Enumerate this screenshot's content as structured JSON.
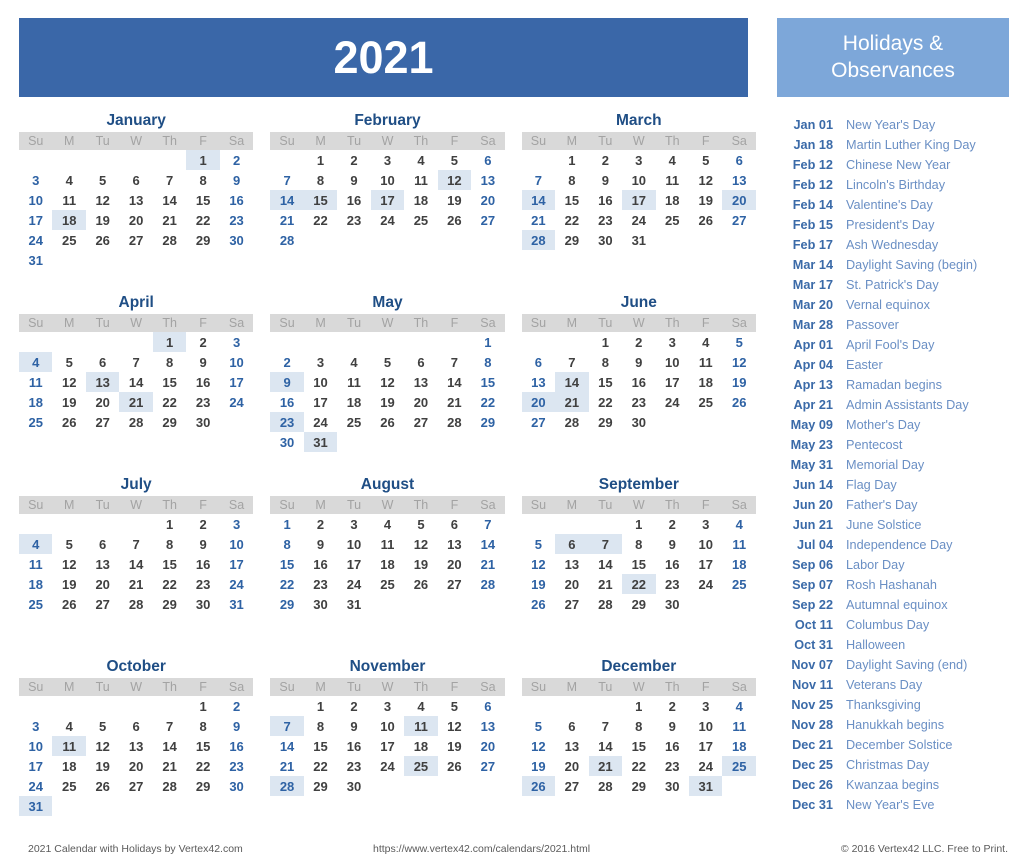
{
  "header": {
    "year_title": "2021",
    "banner_color": "#3a67a8"
  },
  "sidebar": {
    "title": "Holidays & Observances",
    "banner_color": "#7da7d9",
    "date_color": "#3a6aa8",
    "name_color": "#6a8fc4",
    "holidays": [
      {
        "date": "Jan 01",
        "name": "New Year's Day"
      },
      {
        "date": "Jan 18",
        "name": "Martin Luther King Day"
      },
      {
        "date": "Feb 12",
        "name": "Chinese New Year"
      },
      {
        "date": "Feb 12",
        "name": "Lincoln's Birthday"
      },
      {
        "date": "Feb 14",
        "name": "Valentine's Day"
      },
      {
        "date": "Feb 15",
        "name": "President's Day"
      },
      {
        "date": "Feb 17",
        "name": "Ash Wednesday"
      },
      {
        "date": "Mar 14",
        "name": "Daylight Saving (begin)"
      },
      {
        "date": "Mar 17",
        "name": "St. Patrick's Day"
      },
      {
        "date": "Mar 20",
        "name": "Vernal equinox"
      },
      {
        "date": "Mar 28",
        "name": "Passover"
      },
      {
        "date": "Apr 01",
        "name": "April Fool's Day"
      },
      {
        "date": "Apr 04",
        "name": "Easter"
      },
      {
        "date": "Apr 13",
        "name": "Ramadan begins"
      },
      {
        "date": "Apr 21",
        "name": "Admin Assistants Day"
      },
      {
        "date": "May 09",
        "name": "Mother's Day"
      },
      {
        "date": "May 23",
        "name": "Pentecost"
      },
      {
        "date": "May 31",
        "name": "Memorial Day"
      },
      {
        "date": "Jun 14",
        "name": "Flag Day"
      },
      {
        "date": "Jun 20",
        "name": "Father's Day"
      },
      {
        "date": "Jun 21",
        "name": "June Solstice"
      },
      {
        "date": "Jul 04",
        "name": "Independence Day"
      },
      {
        "date": "Sep 06",
        "name": "Labor Day"
      },
      {
        "date": "Sep 07",
        "name": "Rosh Hashanah"
      },
      {
        "date": "Sep 22",
        "name": "Autumnal equinox"
      },
      {
        "date": "Oct 11",
        "name": "Columbus Day"
      },
      {
        "date": "Oct 31",
        "name": "Halloween"
      },
      {
        "date": "Nov 07",
        "name": "Daylight Saving (end)"
      },
      {
        "date": "Nov 11",
        "name": "Veterans Day"
      },
      {
        "date": "Nov 25",
        "name": "Thanksgiving"
      },
      {
        "date": "Nov 28",
        "name": "Hanukkah begins"
      },
      {
        "date": "Dec 21",
        "name": "December Solstice"
      },
      {
        "date": "Dec 25",
        "name": "Christmas Day"
      },
      {
        "date": "Dec 26",
        "name": "Kwanzaa begins"
      },
      {
        "date": "Dec 31",
        "name": "New Year's Eve"
      }
    ]
  },
  "calendar": {
    "weekday_headers": [
      "Su",
      "M",
      "Tu",
      "W",
      "Th",
      "F",
      "Sa"
    ],
    "highlight_color": "#dce6f1",
    "weekend_color": "#2e62a4",
    "weekday_color": "#404040",
    "months": [
      {
        "name": "January",
        "days": 31,
        "start": 5,
        "highlights": [
          1,
          18
        ]
      },
      {
        "name": "February",
        "days": 28,
        "start": 1,
        "highlights": [
          12,
          14,
          15,
          17
        ]
      },
      {
        "name": "March",
        "days": 31,
        "start": 1,
        "highlights": [
          14,
          17,
          20,
          28
        ]
      },
      {
        "name": "April",
        "days": 30,
        "start": 4,
        "highlights": [
          1,
          4,
          13,
          21
        ]
      },
      {
        "name": "May",
        "days": 31,
        "start": 6,
        "highlights": [
          9,
          23,
          31
        ]
      },
      {
        "name": "June",
        "days": 30,
        "start": 2,
        "highlights": [
          14,
          20,
          21
        ]
      },
      {
        "name": "July",
        "days": 31,
        "start": 4,
        "highlights": [
          4
        ]
      },
      {
        "name": "August",
        "days": 31,
        "start": 0,
        "highlights": []
      },
      {
        "name": "September",
        "days": 30,
        "start": 3,
        "highlights": [
          6,
          7,
          22
        ]
      },
      {
        "name": "October",
        "days": 31,
        "start": 5,
        "highlights": [
          11,
          31
        ]
      },
      {
        "name": "November",
        "days": 30,
        "start": 1,
        "highlights": [
          7,
          11,
          25,
          28
        ]
      },
      {
        "name": "December",
        "days": 31,
        "start": 3,
        "highlights": [
          21,
          25,
          26,
          31
        ]
      }
    ]
  },
  "footer": {
    "left": "2021 Calendar with Holidays by Vertex42.com",
    "middle": "https://www.vertex42.com/calendars/2021.html",
    "right": "© 2016 Vertex42 LLC. Free to Print."
  }
}
